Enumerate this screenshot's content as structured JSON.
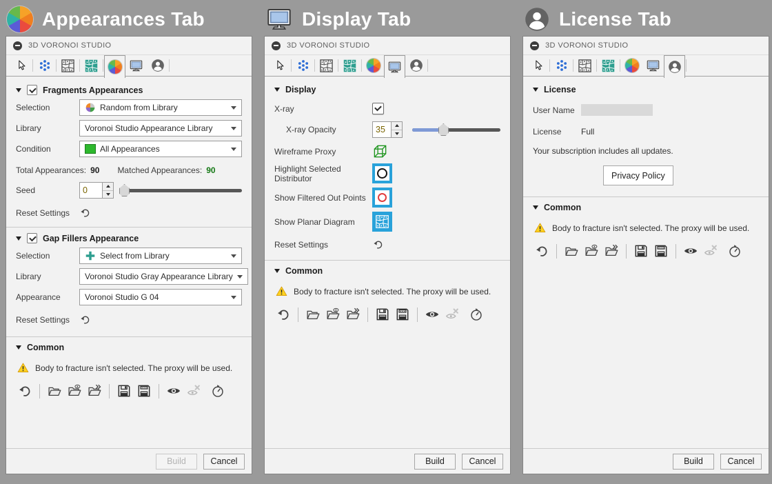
{
  "app": {
    "window_title": "3D VORONOI STUDIO"
  },
  "colors": {
    "accent_blue": "#29a2da",
    "teal": "#2f9f90",
    "points_blue": "#2f6fd6",
    "matched_green": "#157815",
    "warning_yellow": "#ffd21f",
    "slider_blue": "#7f9ad6",
    "background_gray": "#9a9a9a"
  },
  "toolbar_icons": [
    "cursor-icon",
    "points-icon",
    "voronoi-outline-icon",
    "voronoi-solid-icon",
    "color-wheel-icon",
    "monitor-icon",
    "person-icon"
  ],
  "common_icons": [
    "undo-icon",
    "open-folder-icon",
    "open-folder-preview-icon",
    "open-folder-import-icon",
    "save-icon",
    "save-backup-icon",
    "eye-icon",
    "eye-off-icon",
    "timer-icon"
  ],
  "panel_appearances": {
    "header_title": "Appearances Tab",
    "fragments": {
      "title": "Fragments Appearances",
      "selection_label": "Selection",
      "selection_value": "Random from Library",
      "library_label": "Library",
      "library_value": "Voronoi Studio Appearance Library",
      "condition_label": "Condition",
      "condition_value": "All Appearances",
      "total_label": "Total Appearances:",
      "total_value": "90",
      "matched_label": "Matched Appearances:",
      "matched_value": "90",
      "seed_label": "Seed",
      "seed_value": "0",
      "reset_label": "Reset Settings"
    },
    "gap": {
      "title": "Gap Fillers Appearance",
      "selection_label": "Selection",
      "selection_value": "Select from Library",
      "library_label": "Library",
      "library_value": "Voronoi Studio Gray Appearance Library",
      "appearance_label": "Appearance",
      "appearance_value": "Voronoi Studio G 04",
      "reset_label": "Reset Settings"
    }
  },
  "panel_display": {
    "header_title": "Display Tab",
    "section_title": "Display",
    "xray_label": "X-ray",
    "xray_checked": true,
    "opacity_label": "X-ray Opacity",
    "opacity_value": "35",
    "opacity_percent": 35,
    "wireframe_label": "Wireframe Proxy",
    "highlight_label": "Highlight Selected Distributor",
    "filtered_label": "Show Filtered Out Points",
    "planar_label": "Show Planar Diagram",
    "reset_label": "Reset Settings"
  },
  "panel_license": {
    "header_title": "License Tab",
    "section_title": "License",
    "username_label": "User Name",
    "license_label": "License",
    "license_value": "Full",
    "subscription_text": "Your subscription includes all updates.",
    "privacy_button_label": "Privacy Policy"
  },
  "common_section": {
    "title": "Common",
    "warning_text": "Body to fracture isn't selected. The proxy will be used."
  },
  "footer": {
    "build_label": "Build",
    "cancel_label": "Cancel"
  }
}
